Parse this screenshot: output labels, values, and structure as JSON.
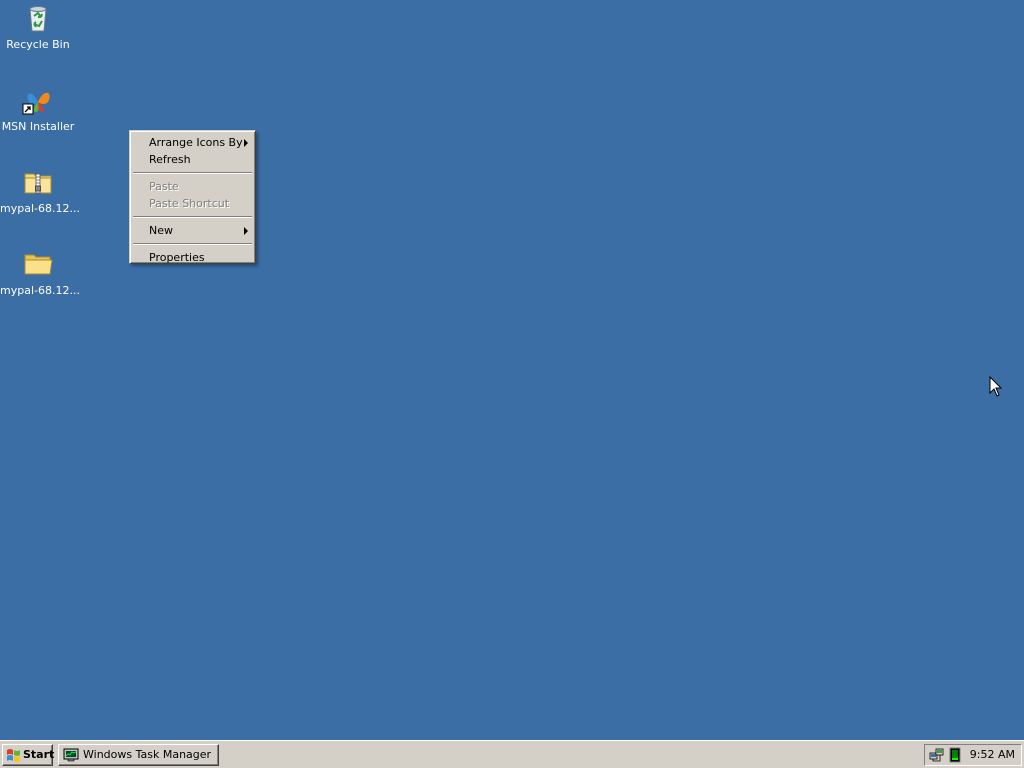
{
  "desktop": {
    "background_color": "#3a6ea5",
    "icons": [
      {
        "label": "Recycle Bin",
        "icon": "recycle-bin-icon"
      },
      {
        "label": "MSN Installer",
        "icon": "msn-butterfly-icon"
      },
      {
        "label": "mypal-68.12...",
        "icon": "zip-folder-icon"
      },
      {
        "label": "mypal-68.12...",
        "icon": "folder-icon"
      }
    ]
  },
  "context_menu": {
    "items": [
      {
        "label": "Arrange Icons By",
        "submenu": true,
        "enabled": true
      },
      {
        "label": "Refresh",
        "submenu": false,
        "enabled": true
      },
      {
        "label": "Paste",
        "submenu": false,
        "enabled": false
      },
      {
        "label": "Paste Shortcut",
        "submenu": false,
        "enabled": false
      },
      {
        "label": "New",
        "submenu": true,
        "enabled": true
      },
      {
        "label": "Properties",
        "submenu": false,
        "enabled": true
      }
    ]
  },
  "taskbar": {
    "start_label": "Start",
    "start_icon": "windows-flag-icon",
    "tasks": [
      {
        "label": "Windows Task Manager",
        "icon": "task-manager-icon"
      }
    ],
    "tray": {
      "icons": [
        "network-icon",
        "cpu-usage-icon"
      ],
      "clock": "9:52 AM"
    }
  }
}
